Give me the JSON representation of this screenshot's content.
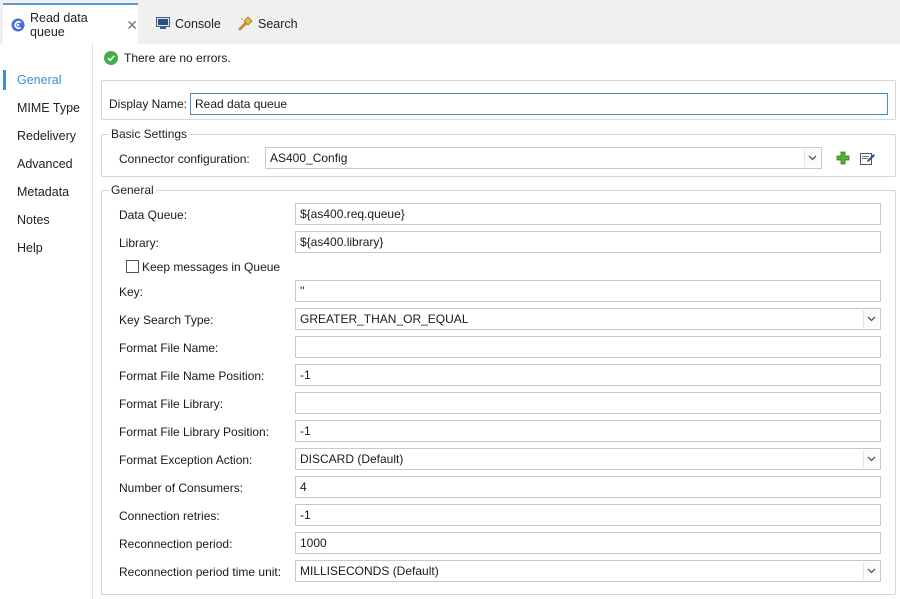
{
  "tabs": [
    {
      "label": "Read data queue",
      "active": true,
      "icon": "connector-icon"
    },
    {
      "label": "Console",
      "icon": "console-icon"
    },
    {
      "label": "Search",
      "icon": "search-flashlight-icon"
    }
  ],
  "sidebar": {
    "items": [
      "General",
      "MIME Type",
      "Redelivery",
      "Advanced",
      "Metadata",
      "Notes",
      "Help"
    ],
    "active": "General"
  },
  "status": {
    "text": "There are no errors.",
    "icon": "check-circle-icon"
  },
  "display_name": {
    "label": "Display Name:",
    "value": "Read data queue"
  },
  "basic_settings": {
    "legend": "Basic Settings",
    "connector_label": "Connector configuration:",
    "connector_value": "AS400_Config",
    "add_icon": "plus-icon",
    "edit_icon": "edit-icon"
  },
  "general": {
    "legend": "General",
    "data_queue": {
      "label": "Data Queue:",
      "value": "${as400.req.queue}"
    },
    "library": {
      "label": "Library:",
      "value": "${as400.library}"
    },
    "keep_messages": {
      "label": "Keep messages in Queue",
      "checked": false
    },
    "key": {
      "label": "Key:",
      "value": "''"
    },
    "key_search_type": {
      "label": "Key Search Type:",
      "value": "GREATER_THAN_OR_EQUAL"
    },
    "format_file_name": {
      "label": "Format File Name:",
      "value": ""
    },
    "format_file_name_position": {
      "label": "Format File Name Position:",
      "value": "-1"
    },
    "format_file_library": {
      "label": "Format File Library:",
      "value": ""
    },
    "format_file_library_position": {
      "label": "Format File Library Position:",
      "value": "-1"
    },
    "format_exception_action": {
      "label": "Format Exception Action:",
      "value": "DISCARD (Default)"
    },
    "number_of_consumers": {
      "label": "Number of Consumers:",
      "value": "4"
    },
    "connection_retries": {
      "label": "Connection retries:",
      "value": "-1"
    },
    "reconnection_period": {
      "label": "Reconnection period:",
      "value": "1000"
    },
    "reconnection_period_time_unit": {
      "label": "Reconnection period time unit:",
      "value": "MILLISECONDS (Default)"
    }
  },
  "colors": {
    "accent": "#3c8fd0",
    "ok": "#3fae49",
    "tab_strip": "#f0f0f0"
  }
}
